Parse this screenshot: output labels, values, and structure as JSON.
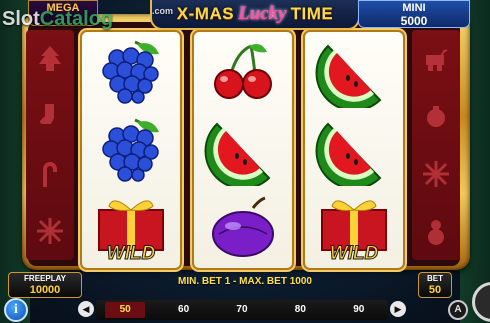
{
  "header": {
    "title_left": "X-MAS",
    "title_lucky": "Lucky",
    "title_right": "TIME"
  },
  "jackpots": {
    "mega_label": "MEGA",
    "mini_label": "MINI",
    "mini_value": "5000"
  },
  "watermark": {
    "slot": "Slot",
    "catalog": "Catalog",
    "com": ".com"
  },
  "reels": [
    [
      {
        "symbol": "grapes-icon"
      },
      {
        "symbol": "grapes-icon"
      },
      {
        "symbol": "wild-gift-icon",
        "label": "WILD"
      }
    ],
    [
      {
        "symbol": "cherries-icon"
      },
      {
        "symbol": "watermelon-icon"
      },
      {
        "symbol": "plum-icon"
      }
    ],
    [
      {
        "symbol": "watermelon-icon"
      },
      {
        "symbol": "watermelon-icon"
      },
      {
        "symbol": "wild-gift-icon",
        "label": "WILD"
      }
    ]
  ],
  "bottom": {
    "freeplay_label": "FREEPLAY",
    "freeplay_value": "10000",
    "bet_label": "BET",
    "bet_value": "50",
    "bet_limits": "MIN. BET 1 - MAX. BET 1000",
    "bet_options": [
      "50",
      "60",
      "70",
      "80",
      "90"
    ],
    "selected_bet": "50",
    "info_label": "i",
    "auto_label": "A",
    "prev_label": "◀",
    "next_label": "▶"
  },
  "colors": {
    "frame_gold": "#e8b94a",
    "side_red": "#7a0f14",
    "title_yellow": "#ffd84a",
    "lucky_pink": "#ff4fa8",
    "mini_blue": "#1f4ea8"
  }
}
